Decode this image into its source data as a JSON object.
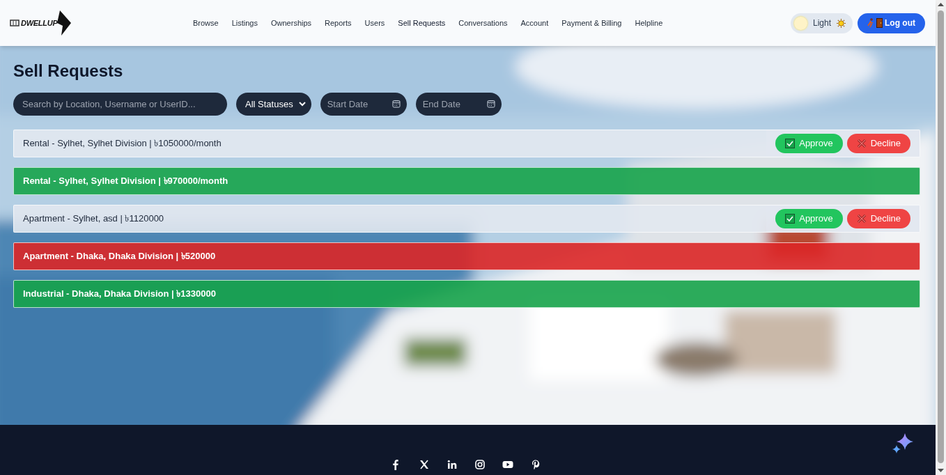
{
  "header": {
    "logo": "DWELLUP",
    "nav": [
      {
        "label": "Browse",
        "selected": false
      },
      {
        "label": "Listings",
        "selected": false
      },
      {
        "label": "Ownerships",
        "selected": false
      },
      {
        "label": "Reports",
        "selected": false
      },
      {
        "label": "Users",
        "selected": false
      },
      {
        "label": "Sell Requests",
        "selected": true
      },
      {
        "label": "Conversations",
        "selected": false
      },
      {
        "label": "Account",
        "selected": false
      },
      {
        "label": "Payment & Billing",
        "selected": false
      },
      {
        "label": "Helpline",
        "selected": false
      }
    ],
    "theme_toggle": {
      "label": "Light",
      "on": false
    },
    "logout": "Log out"
  },
  "page_title": "Sell Requests",
  "filters": {
    "search": {
      "placeholder": "Search by Location, Username or UserID..."
    },
    "status": "All Statuses",
    "start_date": {
      "placeholder": "Start Date"
    },
    "end_date": {
      "placeholder": "End Date"
    }
  },
  "requests": [
    {
      "title": "Rental - Sylhet, Sylhet Division | ৳1050000/month",
      "kind": "pending",
      "approve": "Approve",
      "decline": "Decline"
    },
    {
      "title": "Rental - Sylhet, Sylhet Division | ৳970000/month",
      "kind": "approved"
    },
    {
      "title": "Apartment - Sylhet, asd | ৳1120000",
      "kind": "pending",
      "approve": "Approve",
      "decline": "Decline"
    },
    {
      "title": "Apartment - Dhaka, Dhaka Division | ৳520000",
      "kind": "declined"
    },
    {
      "title": "Industrial - Dhaka, Dhaka Division | ৳1330000",
      "kind": "approved"
    }
  ],
  "footer": {
    "social": [
      {
        "kind": "facebook"
      },
      {
        "kind": "x"
      },
      {
        "kind": "linkedin"
      },
      {
        "kind": "instagram"
      },
      {
        "kind": "youtube"
      },
      {
        "kind": "pinterest"
      }
    ]
  }
}
